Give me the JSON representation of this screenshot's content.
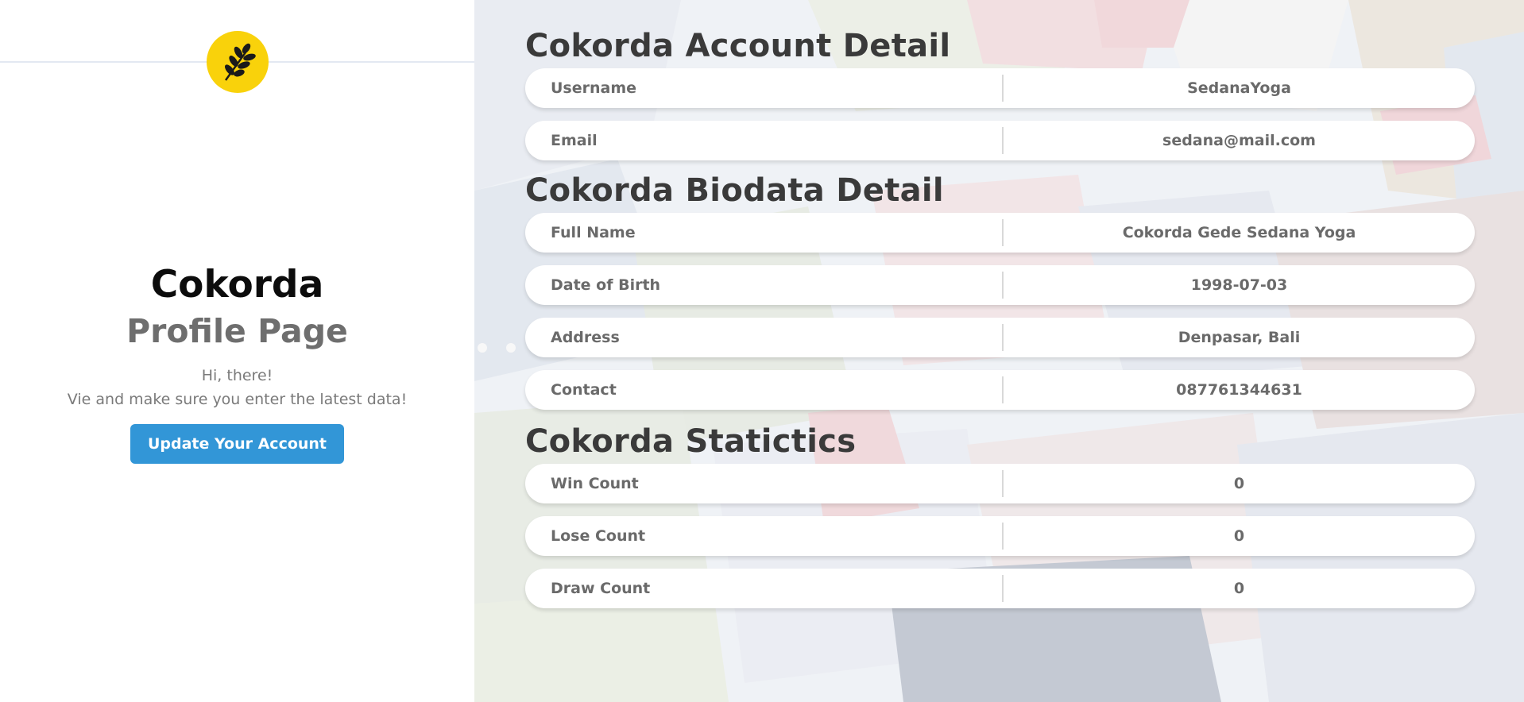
{
  "left_panel": {
    "logo_icon": "wheat-leaf-icon",
    "profile_name": "Cokorda",
    "profile_subtitle": "Profile Page",
    "greeting": "Hi, there!",
    "instruction": "Vie and make sure you enter the latest data!",
    "update_button_label": "Update Your Account",
    "accent_color": "#3296d7",
    "logo_color": "#f9d20b"
  },
  "account": {
    "title": "Cokorda Account Detail",
    "rows": [
      {
        "label": "Username",
        "value": "SedanaYoga"
      },
      {
        "label": "Email",
        "value": "sedana@mail.com"
      }
    ]
  },
  "biodata": {
    "title": "Cokorda Biodata Detail",
    "rows": [
      {
        "label": "Full Name",
        "value": "Cokorda Gede Sedana Yoga"
      },
      {
        "label": "Date of Birth",
        "value": "1998-07-03"
      },
      {
        "label": "Address",
        "value": "Denpasar, Bali"
      },
      {
        "label": "Contact",
        "value": "087761344631"
      }
    ]
  },
  "statistics": {
    "title": "Cokorda Statictics",
    "rows": [
      {
        "label": "Win Count",
        "value": "0"
      },
      {
        "label": "Lose Count",
        "value": "0"
      },
      {
        "label": "Draw Count",
        "value": "0"
      }
    ]
  }
}
